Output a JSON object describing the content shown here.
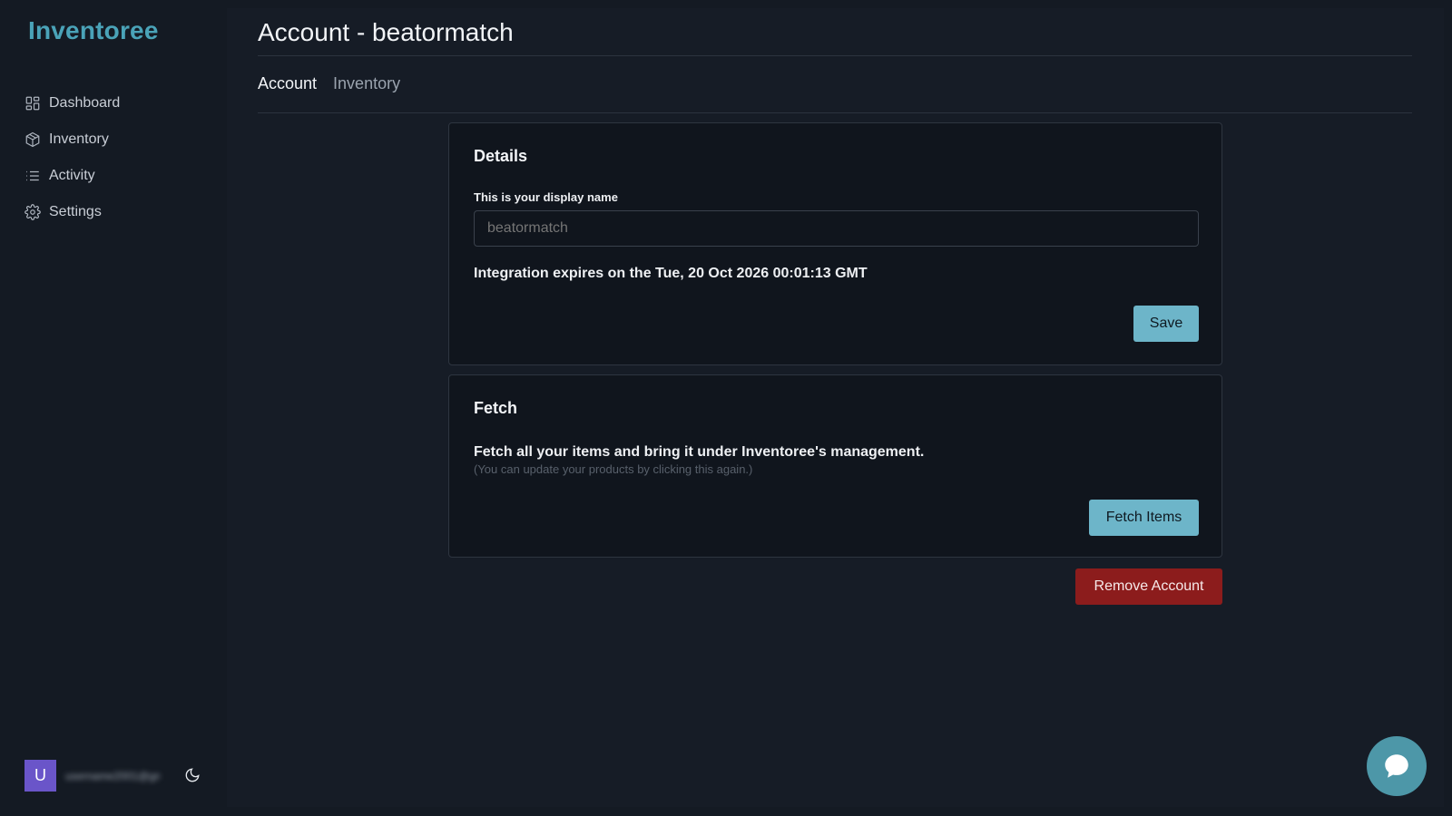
{
  "app": {
    "name": "Inventoree"
  },
  "sidebar": {
    "items": [
      {
        "label": "Dashboard",
        "icon": "dashboard-icon"
      },
      {
        "label": "Inventory",
        "icon": "box-icon"
      },
      {
        "label": "Activity",
        "icon": "list-icon"
      },
      {
        "label": "Settings",
        "icon": "gear-icon"
      }
    ],
    "user": {
      "initial": "U",
      "email": "username2001@gmail.com",
      "theme_icon": "moon-icon"
    }
  },
  "header": {
    "title": "Account - beatormatch"
  },
  "tabs": [
    {
      "label": "Account",
      "active": true
    },
    {
      "label": "Inventory",
      "active": false
    }
  ],
  "details": {
    "title": "Details",
    "display_name_label": "This is your display name",
    "display_name_value": "",
    "display_name_placeholder": "beatormatch",
    "expiry_text": "Integration expires on the Tue, 20 Oct 2026 00:01:13 GMT",
    "save_label": "Save"
  },
  "fetch": {
    "title": "Fetch",
    "description": "Fetch all your items and bring it under Inventoree's management.",
    "hint": "(You can update your products by clicking this again.)",
    "button_label": "Fetch Items"
  },
  "danger": {
    "remove_label": "Remove Account"
  },
  "colors": {
    "accent": "#4aa3b8",
    "primary_button": "#6db5c9",
    "danger_button": "#8c1c1c",
    "avatar": "#6a55c9",
    "chat": "#4d97a8"
  }
}
